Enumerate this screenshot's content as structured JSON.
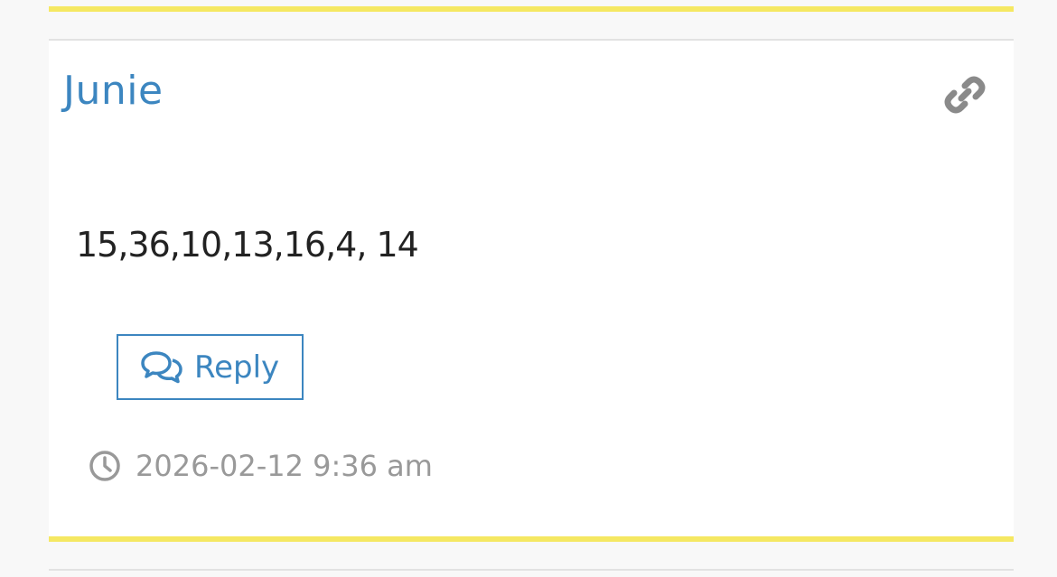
{
  "comment": {
    "author": "Junie",
    "text": "15,36,10,13,16,4, 14",
    "reply_label": "Reply",
    "timestamp": "2026-02-12 9:36 am"
  },
  "icons": {
    "permalink": "link-icon",
    "reply": "speech-bubbles-icon",
    "time": "clock-icon"
  },
  "colors": {
    "accent": "#3c86c0",
    "highlight_bar": "#f5e862",
    "muted_text": "#999999",
    "body_text": "#222222"
  }
}
